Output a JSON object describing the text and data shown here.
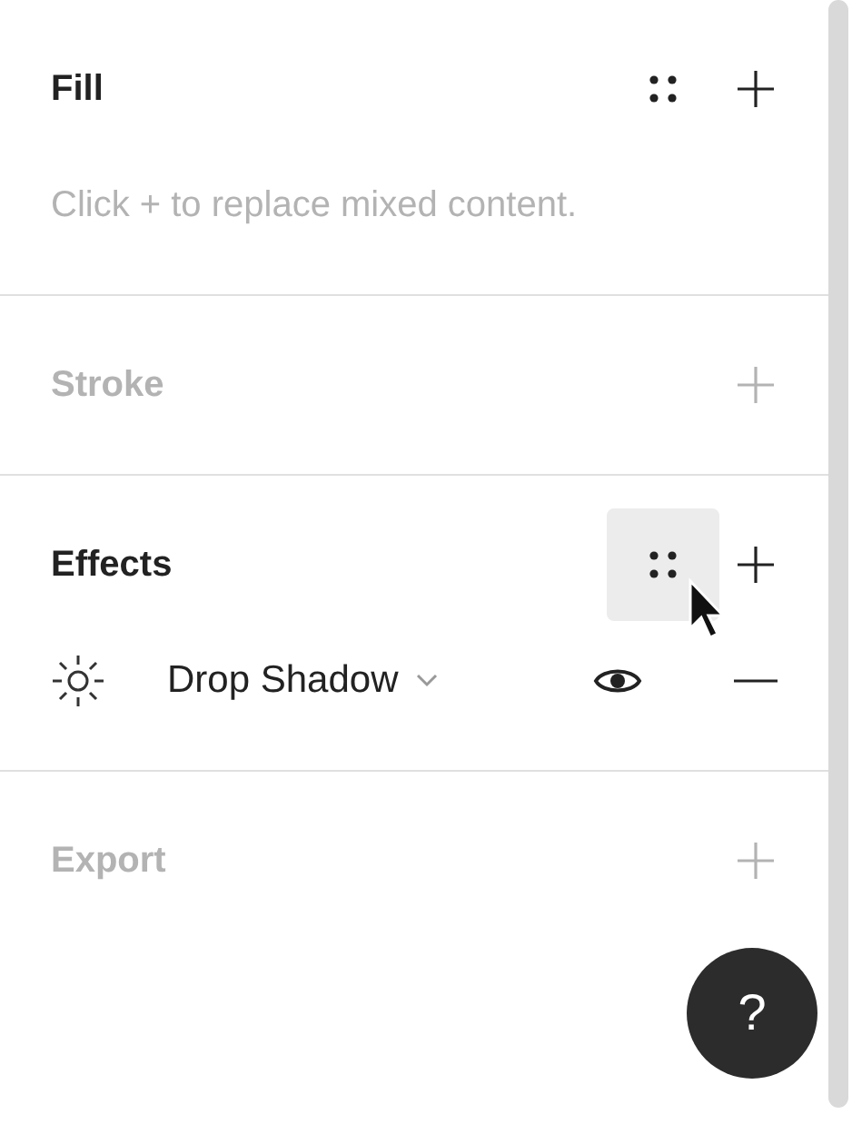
{
  "sections": [
    {
      "title": "Fill",
      "disabled": false,
      "styles_button": {
        "hovered": false
      },
      "hint": "Click + to replace mixed content."
    },
    {
      "title": "Stroke",
      "disabled": true
    },
    {
      "title": "Effects",
      "disabled": false,
      "styles_button": {
        "hovered": true
      },
      "effects": [
        {
          "name": "Drop Shadow",
          "visible": true
        }
      ]
    },
    {
      "title": "Export",
      "disabled": true
    }
  ],
  "help_button": {
    "label": "?"
  }
}
